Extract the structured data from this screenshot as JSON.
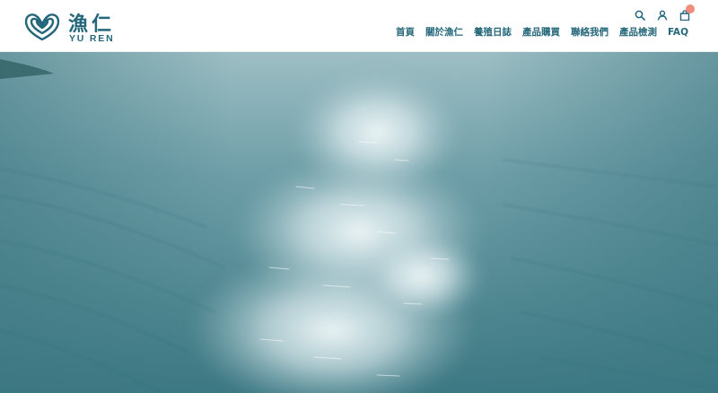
{
  "brand": {
    "name_zh": "漁仁",
    "name_en": "YU REN",
    "logo_icon": "yuren-logo-mark",
    "brand_color": "#24677a"
  },
  "header": {
    "utilities": [
      {
        "name": "search",
        "icon": "search-icon"
      },
      {
        "name": "account",
        "icon": "user-icon"
      },
      {
        "name": "cart",
        "icon": "shopping-bag-icon",
        "badge_color": "#f08c7a"
      }
    ],
    "nav": [
      {
        "label": "首頁"
      },
      {
        "label": "關於漁仁"
      },
      {
        "label": "養殖日誌"
      },
      {
        "label": "產品購買"
      },
      {
        "label": "聯絡我們"
      },
      {
        "label": "產品檢測"
      },
      {
        "label": "FAQ"
      }
    ]
  },
  "hero": {
    "image": "aerial-ocean-sunlight",
    "colors": {
      "deep": "#3f7f8a",
      "mid": "#6a9da6",
      "light": "#a9c6cc",
      "glare": "#f2f8fa"
    }
  }
}
